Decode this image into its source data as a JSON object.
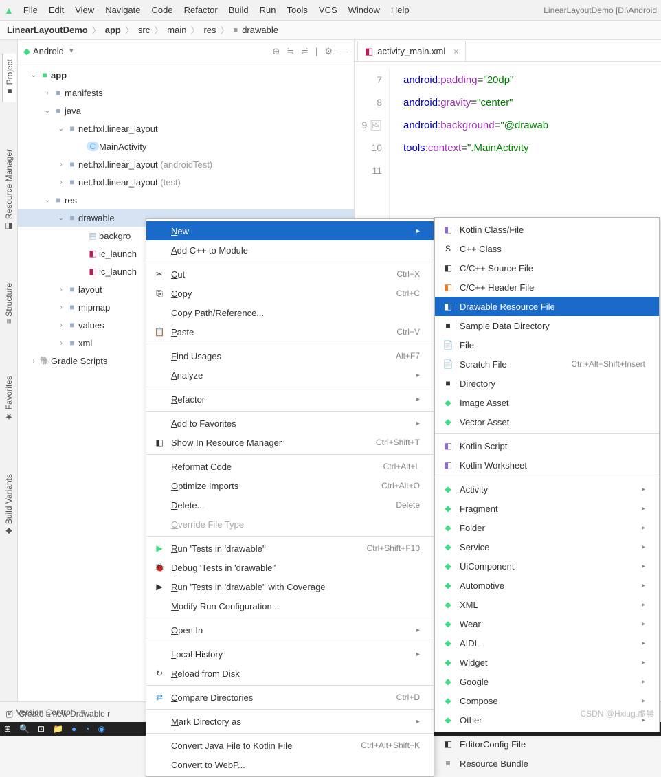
{
  "menubar": {
    "items": [
      "File",
      "Edit",
      "View",
      "Navigate",
      "Code",
      "Refactor",
      "Build",
      "Run",
      "Tools",
      "VCS",
      "Window",
      "Help"
    ],
    "title_right": "LinearLayoutDemo [D:\\Android"
  },
  "breadcrumb": {
    "items": [
      "LinearLayoutDemo",
      "app",
      "src",
      "main",
      "res",
      "drawable"
    ]
  },
  "project_panel": {
    "title": "Android"
  },
  "tree": {
    "app": "app",
    "manifests": "manifests",
    "java": "java",
    "pkg1": "net.hxl.linear_layout",
    "main_activity": "MainActivity",
    "pkg2": "net.hxl.linear_layout",
    "pkg2_sub": "(androidTest)",
    "pkg3": "net.hxl.linear_layout",
    "pkg3_sub": "(test)",
    "res": "res",
    "drawable": "drawable",
    "backgro": "backgro",
    "ic1": "ic_launch",
    "ic2": "ic_launch",
    "layout": "layout",
    "mipmap": "mipmap",
    "values": "values",
    "xml": "xml",
    "gradle": "Gradle Scripts"
  },
  "editor": {
    "tab": "activity_main.xml",
    "lines": {
      "l7": {
        "ns": "android",
        "attr": "padding",
        "val": "\"20dp\""
      },
      "l8": {
        "ns": "android",
        "attr": "gravity",
        "val": "\"center\""
      },
      "l9": {
        "ns": "android",
        "attr": "background",
        "val": "\"@drawab"
      },
      "l10": {
        "ns": "tools",
        "attr": "context",
        "val": "\".MainActivity"
      },
      "nums": [
        "7",
        "8",
        "9",
        "10",
        "11"
      ]
    }
  },
  "context_menu": {
    "items": [
      {
        "label": "New",
        "arrow": true,
        "hl": true
      },
      {
        "label": "Add C++ to Module"
      },
      {
        "sep": true
      },
      {
        "label": "Cut",
        "short": "Ctrl+X",
        "icon": "✂"
      },
      {
        "label": "Copy",
        "short": "Ctrl+C",
        "icon": "⎘"
      },
      {
        "label": "Copy Path/Reference..."
      },
      {
        "label": "Paste",
        "short": "Ctrl+V",
        "icon": "📋"
      },
      {
        "sep": true
      },
      {
        "label": "Find Usages",
        "short": "Alt+F7"
      },
      {
        "label": "Analyze",
        "arrow": true
      },
      {
        "sep": true
      },
      {
        "label": "Refactor",
        "arrow": true
      },
      {
        "sep": true
      },
      {
        "label": "Add to Favorites",
        "arrow": true
      },
      {
        "label": "Show In Resource Manager",
        "short": "Ctrl+Shift+T",
        "icon": "◧"
      },
      {
        "sep": true
      },
      {
        "label": "Reformat Code",
        "short": "Ctrl+Alt+L"
      },
      {
        "label": "Optimize Imports",
        "short": "Ctrl+Alt+O"
      },
      {
        "label": "Delete...",
        "short": "Delete"
      },
      {
        "label": "Override File Type",
        "disabled": true
      },
      {
        "sep": true
      },
      {
        "label": "Run 'Tests in 'drawable''",
        "short": "Ctrl+Shift+F10",
        "icon": "▶",
        "iconc": "green-icon"
      },
      {
        "label": "Debug 'Tests in 'drawable''",
        "icon": "🐞",
        "iconc": "green-icon"
      },
      {
        "label": "Run 'Tests in 'drawable'' with Coverage",
        "icon": "▶"
      },
      {
        "label": "Modify Run Configuration..."
      },
      {
        "sep": true
      },
      {
        "label": "Open In",
        "arrow": true
      },
      {
        "sep": true
      },
      {
        "label": "Local History",
        "arrow": true
      },
      {
        "label": "Reload from Disk",
        "icon": "↻"
      },
      {
        "sep": true
      },
      {
        "label": "Compare Directories",
        "short": "Ctrl+D",
        "icon": "⇄",
        "iconc": "blue-icon"
      },
      {
        "sep": true
      },
      {
        "label": "Mark Directory as",
        "arrow": true
      },
      {
        "sep": true
      },
      {
        "label": "Convert Java File to Kotlin File",
        "short": "Ctrl+Alt+Shift+K"
      },
      {
        "label": "Convert to WebP..."
      }
    ]
  },
  "submenu": {
    "items": [
      {
        "label": "Kotlin Class/File",
        "icon": "◧",
        "iconc": "purple-icon"
      },
      {
        "label": "C++ Class",
        "icon": "S"
      },
      {
        "label": "C/C++ Source File",
        "icon": "◧"
      },
      {
        "label": "C/C++ Header File",
        "icon": "◧",
        "iconc": "orange-icon"
      },
      {
        "label": "Drawable Resource File",
        "hl": true,
        "icon": "◧"
      },
      {
        "label": "Sample Data Directory",
        "icon": "■"
      },
      {
        "label": "File",
        "icon": "📄"
      },
      {
        "label": "Scratch File",
        "short": "Ctrl+Alt+Shift+Insert",
        "icon": "📄"
      },
      {
        "label": "Directory",
        "icon": "■"
      },
      {
        "label": "Image Asset",
        "icon": "◆",
        "iconc": "green-icon"
      },
      {
        "label": "Vector Asset",
        "icon": "◆",
        "iconc": "green-icon"
      },
      {
        "sep": true
      },
      {
        "label": "Kotlin Script",
        "icon": "◧",
        "iconc": "purple-icon"
      },
      {
        "label": "Kotlin Worksheet",
        "icon": "◧",
        "iconc": "purple-icon"
      },
      {
        "sep": true
      },
      {
        "label": "Activity",
        "arrow": true,
        "icon": "◆",
        "iconc": "green-icon"
      },
      {
        "label": "Fragment",
        "arrow": true,
        "icon": "◆",
        "iconc": "green-icon"
      },
      {
        "label": "Folder",
        "arrow": true,
        "icon": "◆",
        "iconc": "green-icon"
      },
      {
        "label": "Service",
        "arrow": true,
        "icon": "◆",
        "iconc": "green-icon"
      },
      {
        "label": "UiComponent",
        "arrow": true,
        "icon": "◆",
        "iconc": "green-icon"
      },
      {
        "label": "Automotive",
        "arrow": true,
        "icon": "◆",
        "iconc": "green-icon"
      },
      {
        "label": "XML",
        "arrow": true,
        "icon": "◆",
        "iconc": "green-icon"
      },
      {
        "label": "Wear",
        "arrow": true,
        "icon": "◆",
        "iconc": "green-icon"
      },
      {
        "label": "AIDL",
        "arrow": true,
        "icon": "◆",
        "iconc": "green-icon"
      },
      {
        "label": "Widget",
        "arrow": true,
        "icon": "◆",
        "iconc": "green-icon"
      },
      {
        "label": "Google",
        "arrow": true,
        "icon": "◆",
        "iconc": "green-icon"
      },
      {
        "label": "Compose",
        "arrow": true,
        "icon": "◆",
        "iconc": "green-icon"
      },
      {
        "label": "Other",
        "arrow": true,
        "icon": "◆",
        "iconc": "green-icon"
      },
      {
        "sep": true
      },
      {
        "label": "EditorConfig File",
        "icon": "◧"
      },
      {
        "label": "Resource Bundle",
        "icon": "≡"
      }
    ]
  },
  "left_tabs": {
    "project": "Project",
    "resource": "Resource Manager",
    "structure": "Structure",
    "favorites": "Favorites",
    "build": "Build Variants"
  },
  "statusbar": {
    "version": "Version Control",
    "hint": "Create a new Drawable r"
  },
  "watermark": "CSDN @Hxiug.虚晨"
}
